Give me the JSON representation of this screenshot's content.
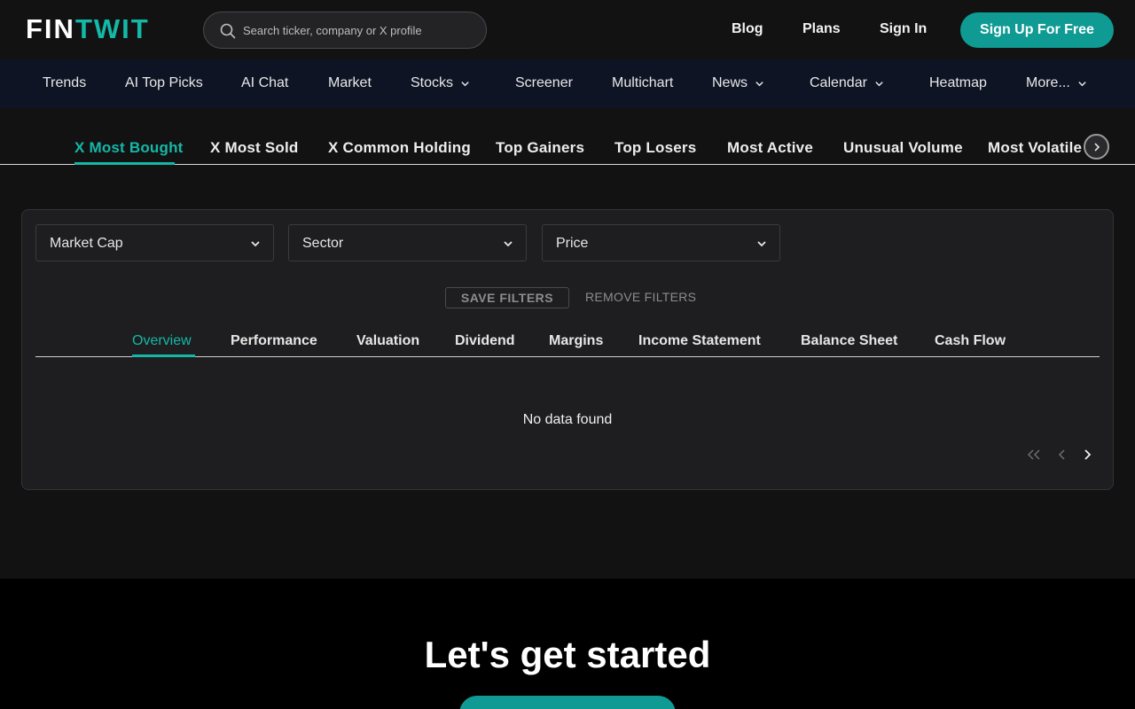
{
  "brand": {
    "logo_part1": "FIN",
    "logo_part2": "TWIT",
    "accent": "#14b8a6"
  },
  "search": {
    "placeholder": "Search ticker, company or X profile",
    "value": ""
  },
  "header": {
    "theme_toggle_icon": "moon-icon",
    "links": [
      "Blog",
      "Plans",
      "Sign In"
    ],
    "signup_label": "Sign Up For Free"
  },
  "nav": {
    "items": [
      {
        "label": "Trends",
        "dropdown": false
      },
      {
        "label": "AI Top Picks",
        "dropdown": false
      },
      {
        "label": "AI Chat",
        "dropdown": false
      },
      {
        "label": "Market",
        "dropdown": false
      },
      {
        "label": "Stocks",
        "dropdown": true
      },
      {
        "label": "Screener",
        "dropdown": false
      },
      {
        "label": "Multichart",
        "dropdown": false
      },
      {
        "label": "News",
        "dropdown": true
      },
      {
        "label": "Calendar",
        "dropdown": true
      },
      {
        "label": "Heatmap",
        "dropdown": false
      },
      {
        "label": "More...",
        "dropdown": true
      }
    ]
  },
  "categories": {
    "active": "X Most Bought",
    "tabs": [
      "X Most Bought",
      "X Most Sold",
      "X Common Holding",
      "Top Gainers",
      "Top Losers",
      "Most Active",
      "Unusual Volume",
      "Most Volatile"
    ]
  },
  "filters": {
    "selects": [
      "Market Cap",
      "Sector",
      "Price"
    ],
    "save_label": "SAVE FILTERS",
    "remove_label": "REMOVE FILTERS"
  },
  "data_tabs": {
    "active": "Overview",
    "tabs": [
      "Overview",
      "Performance",
      "Valuation",
      "Dividend",
      "Margins",
      "Income Statement",
      "Balance Sheet",
      "Cash Flow"
    ]
  },
  "table": {
    "empty_message": "No data found"
  },
  "cta": {
    "title": "Let's get started"
  }
}
